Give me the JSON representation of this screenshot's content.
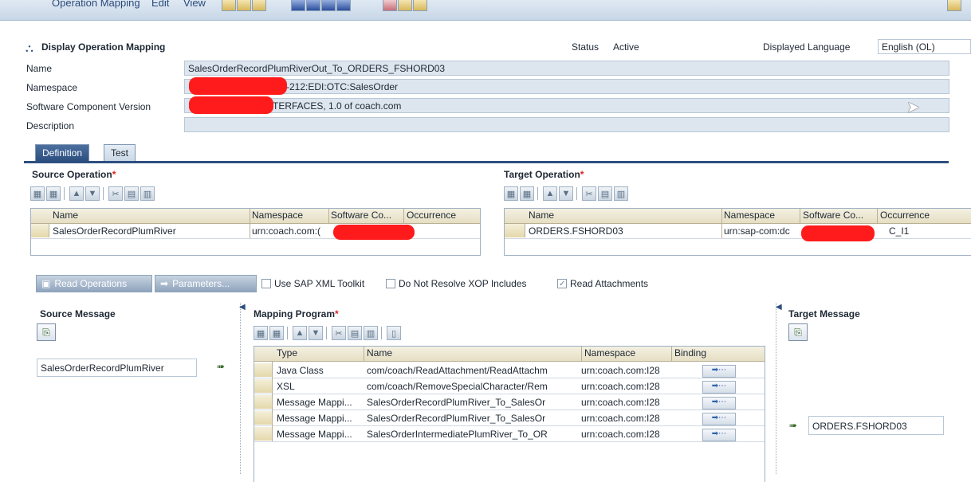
{
  "menubar": {
    "items": [
      "Operation Mapping",
      "Edit",
      "View"
    ]
  },
  "header": {
    "title": "Display Operation Mapping",
    "status_label": "Status",
    "status_value": "Active",
    "language_label": "Displayed Language",
    "language_value": "English (OL)"
  },
  "fields": {
    "name_label": "Name",
    "name_value": "SalesOrderRecordPlumRiverOut_To_ORDERS_FSHORD03",
    "namespace_label": "Namespace",
    "namespace_value": "-212:EDI:OTC:SalesOrder",
    "swcv_label": "Software Component Version",
    "swcv_value": "TERFACES, 1.0 of coach.com",
    "description_label": "Description",
    "description_value": ""
  },
  "tabs": [
    {
      "label": "Definition",
      "active": true
    },
    {
      "label": "Test",
      "active": false
    }
  ],
  "source_operation": {
    "title": "Source Operation",
    "required": "*",
    "columns": [
      "Name",
      "Namespace",
      "Software Co...",
      "Occurrence"
    ],
    "rows": [
      {
        "name": "SalesOrderRecordPlumRiver",
        "namespace": "urn:coach.com:(",
        "software": "",
        "occurrence": ""
      }
    ]
  },
  "target_operation": {
    "title": "Target Operation",
    "required": "*",
    "columns": [
      "Name",
      "Namespace",
      "Software Co...",
      "Occurrence"
    ],
    "rows": [
      {
        "name": "ORDERS.FSHORD03",
        "namespace": "urn:sap-com:dc",
        "software": "",
        "occurrence": "C_I1"
      }
    ]
  },
  "actions": {
    "read_operations": "Read Operations",
    "parameters": "Parameters...",
    "use_sap_xml_toolkit": "Use SAP XML Toolkit",
    "do_not_resolve_xop": "Do Not Resolve XOP Includes",
    "read_attachments": "Read Attachments",
    "read_attachments_checked": true
  },
  "source_message": {
    "title": "Source Message",
    "value": "SalesOrderRecordPlumRiver"
  },
  "mapping_program": {
    "title": "Mapping Program",
    "required": "*",
    "columns": [
      "Type",
      "Name",
      "Namespace",
      "Binding"
    ],
    "rows": [
      {
        "type": "Java Class",
        "name": "com/coach/ReadAttachment/ReadAttachm",
        "namespace": "urn:coach.com:I28"
      },
      {
        "type": "XSL",
        "name": "com/coach/RemoveSpecialCharacter/Rem",
        "namespace": "urn:coach.com:I28"
      },
      {
        "type": "Message Mappi...",
        "name": "SalesOrderRecordPlumRiver_To_SalesOr",
        "namespace": "urn:coach.com:I28"
      },
      {
        "type": "Message Mappi...",
        "name": "SalesOrderRecordPlumRiver_To_SalesOr",
        "namespace": "urn:coach.com:I28"
      },
      {
        "type": "Message Mappi...",
        "name": "SalesOrderIntermediatePlumRiver_To_OR",
        "namespace": "urn:coach.com:I28"
      }
    ]
  },
  "target_message": {
    "title": "Target Message",
    "value": "ORDERS.FSHORD03"
  }
}
